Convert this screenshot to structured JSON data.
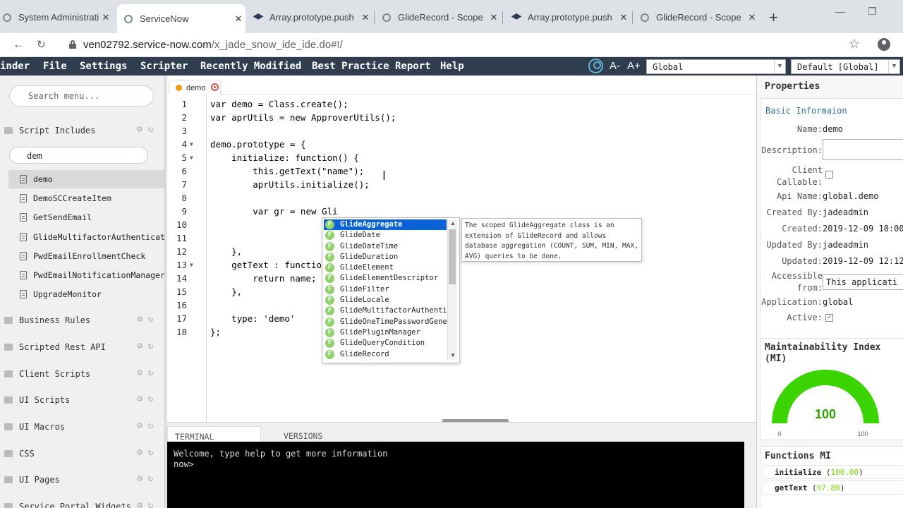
{
  "browser": {
    "tabs": [
      {
        "title": "System Administratio",
        "icon": "ring"
      },
      {
        "title": "ServiceNow",
        "icon": "ring"
      },
      {
        "title": "Array.prototype.push",
        "icon": "cap"
      },
      {
        "title": "GlideRecord - Scope",
        "icon": "ring"
      },
      {
        "title": "Array.prototype.push",
        "icon": "cap"
      },
      {
        "title": "GlideRecord - Scope",
        "icon": "ring"
      }
    ],
    "url_domain": "ven02792.service-now.com",
    "url_path": "/x_jade_snow_ide_ide.do#!/"
  },
  "menubar": {
    "items": [
      "inder",
      "File",
      "Settings",
      "Scripter",
      "Recently Modified",
      "Best Practice Report",
      "Help"
    ],
    "font_minus": "A-",
    "font_plus": "A+",
    "scope_select": "Global",
    "update_set_select": "Default [Global]"
  },
  "sidebar": {
    "search_placeholder": "Search menu...",
    "filter_value": "dem",
    "sections": [
      "Script Includes",
      "Business Rules",
      "Scripted Rest API",
      "Client Scripts",
      "UI Scripts",
      "UI Macros",
      "CSS",
      "UI Pages",
      "Service Portal Widgets"
    ],
    "items": [
      "demo",
      "DemoSCCreateItem",
      "GetSendEmail",
      "GlideMultifactorAuthenticator",
      "PwdEmailEnrollmentCheck",
      "PwdEmailNotificationManager",
      "UpgradeMonitor"
    ],
    "selected_item": "demo"
  },
  "editor": {
    "tab_label": "demo",
    "line_numbers": [
      "1",
      "2",
      "3",
      "4",
      "5",
      "6",
      "7",
      "8",
      "9",
      "10",
      "11",
      "12",
      "13",
      "14",
      "15",
      "16",
      "17",
      "18"
    ],
    "lines": [
      "var demo = Class.create();",
      "var aprUtils = new ApproverUtils();",
      "",
      "demo.prototype = {",
      "    initialize: function() {",
      "        this.getText(\"name\");",
      "        aprUtils.initialize();",
      "",
      "        var gr = new Gli",
      "",
      "",
      "    },",
      "    getText : functio",
      "        return name;",
      "    },",
      "",
      "    type: 'demo'",
      "};"
    ],
    "autocomplete": [
      "GlideAggregate",
      "GlideDate",
      "GlideDateTime",
      "GlideDuration",
      "GlideElement",
      "GlideElementDescriptor",
      "GlideFilter",
      "GlideLocale",
      "GlideMultifactorAuthenticat",
      "GlideOneTimePasswordGenerat",
      "GlidePluginManager",
      "GlideQueryCondition",
      "GlideRecord"
    ],
    "autocomplete_badge": "F",
    "tooltip": "The scoped GlideAggregate class is an extension of GlideRecord and allows database aggregation (COUNT, SUM, MIN, MAX, AVG) queries to be done."
  },
  "terminal": {
    "tabs": [
      "TERMINAL",
      "VERSIONS"
    ],
    "line1": "Welcome, type help to get more information",
    "line2": "now>"
  },
  "properties": {
    "title": "Properties",
    "section": "Basic Informaion",
    "name_label": "Name:",
    "name": "demo",
    "description_label": "Description:",
    "client_callable_label1": "Client",
    "client_callable_label2": "Callable:",
    "api_name_label": "Api Name:",
    "api_name": "global.demo",
    "created_by_label": "Created By:",
    "created_by": "jadeadmin",
    "created_label": "Created:",
    "created": "2019-12-09 10:00:",
    "updated_by_label": "Updated By:",
    "updated_by": "jadeadmin",
    "updated_label": "Updated:",
    "updated": "2019-12-09 12:12:",
    "accessible_label1": "Accessible",
    "accessible_label2": "from:",
    "accessible": "This applicati",
    "application_label": "Application:",
    "application": "global",
    "active_label": "Active:",
    "active_check": "✓"
  },
  "mi": {
    "title": "Maintainability Index (MI)",
    "value": "100",
    "min": "0",
    "max": "100",
    "fraction": 1.0,
    "color": "#3ad400"
  },
  "functions_mi": {
    "title": "Functions MI",
    "rows": [
      {
        "name": "initialize",
        "value": "100.00"
      },
      {
        "name": "getText",
        "value": "97.80"
      }
    ]
  }
}
